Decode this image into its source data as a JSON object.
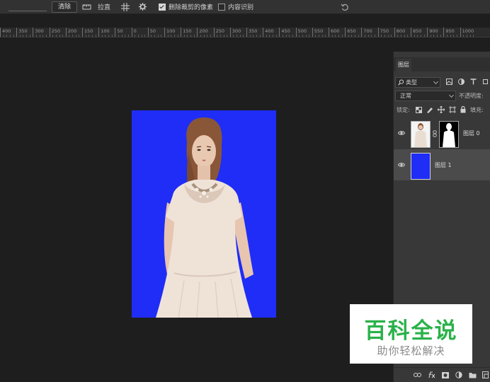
{
  "options_bar": {
    "clear_label": "清除",
    "straighten_label": "拉直",
    "delete_cropped_label": "删除裁剪的像素",
    "delete_cropped_checked": true,
    "content_aware_label": "内容识别",
    "content_aware_checked": false
  },
  "ruler": {
    "labels": [
      "400",
      "350",
      "300",
      "250",
      "200",
      "150",
      "100",
      "50",
      "0",
      "50",
      "100",
      "150",
      "200",
      "250",
      "300",
      "350",
      "400",
      "450",
      "500",
      "550",
      "600",
      "650",
      "700",
      "750",
      "800",
      "850",
      "900",
      "950",
      "1000"
    ]
  },
  "layers_panel": {
    "tab_label": "图层",
    "filter_kind": "类型",
    "blend_mode": "正常",
    "opacity_label": "不透明度:",
    "lock_label": "锁定:",
    "fill_label": "填充:",
    "layers": [
      {
        "name": "图层 0",
        "selected": false,
        "has_mask": true
      },
      {
        "name": "图层 1",
        "selected": true,
        "has_mask": false
      }
    ]
  },
  "canvas": {
    "background_color": "#1f2df7"
  },
  "watermark": {
    "title": "百科全说",
    "subtitle": "助你轻松解决",
    "title_color": "#2ab24a"
  }
}
